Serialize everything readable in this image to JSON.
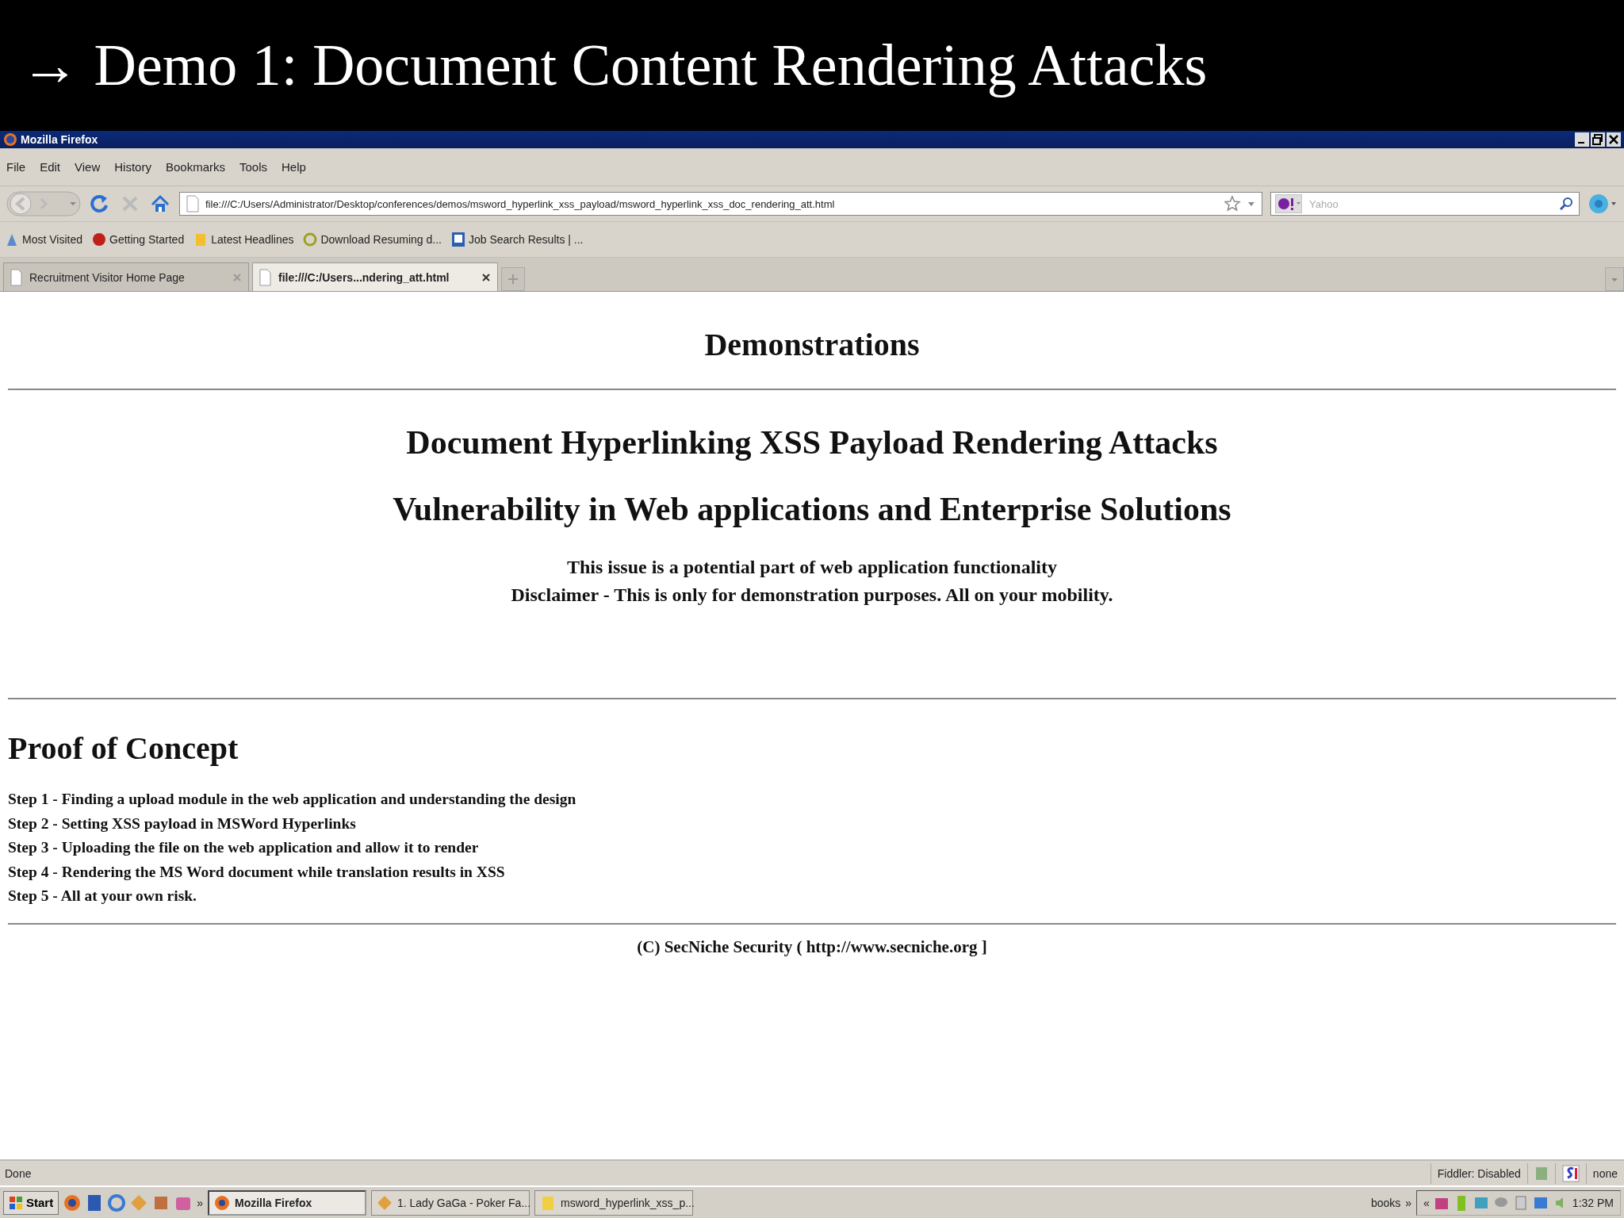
{
  "slide": {
    "title": "→ Demo 1: Document Content Rendering Attacks"
  },
  "window": {
    "title": "Mozilla Firefox"
  },
  "menu": [
    "File",
    "Edit",
    "View",
    "History",
    "Bookmarks",
    "Tools",
    "Help"
  ],
  "address_bar": {
    "value": "file:///C:/Users/Administrator/Desktop/conferences/demos/msword_hyperlink_xss_payload/msword_hyperlink_xss_doc_rendering_att.html"
  },
  "search": {
    "placeholder": "Yahoo"
  },
  "bookmarks": [
    "Most Visited",
    "Getting Started",
    "Latest Headlines",
    "Download Resuming d...",
    "Job Search Results | ..."
  ],
  "tabs": [
    {
      "label": "Recruitment Visitor Home Page",
      "selected": false
    },
    {
      "label": "file:///C:/Users...ndering_att.html",
      "selected": true
    }
  ],
  "page": {
    "heading": "Demonstrations",
    "titles": [
      "Document Hyperlinking XSS Payload Rendering Attacks",
      "Vulnerability in Web applications and Enterprise Solutions"
    ],
    "notes": [
      "This issue is a potential part of web application functionality",
      "Disclaimer - This is only for demonstration purposes. All on your mobility."
    ],
    "section_heading": "Proof of Concept",
    "steps": [
      "Step 1 - Finding a upload module in the web application and understanding the design",
      "Step 2 - Setting XSS payload in MSWord Hyperlinks",
      "Step 3 - Uploading the file on the web application and allow it to render",
      "Step 4 - Rendering the MS Word document while translation results in XSS",
      "Step 5 - All at your own risk."
    ],
    "footer": "(C) SecNiche Security ( http://www.secniche.org ]"
  },
  "status_bar": {
    "text": "Done",
    "panels": [
      "Fiddler: Disabled",
      "none"
    ]
  },
  "taskbar": {
    "start": "Start",
    "more": "»",
    "tasks": [
      {
        "label": "Mozilla Firefox",
        "selected": true
      },
      {
        "label": "1. Lady GaGa - Poker Fa...",
        "selected": false
      },
      {
        "label": "msword_hyperlink_xss_p...",
        "selected": false
      }
    ],
    "toolbar_label": "books",
    "toolbar_more": "»",
    "tray_expand": "«",
    "clock": "1:32 PM"
  }
}
